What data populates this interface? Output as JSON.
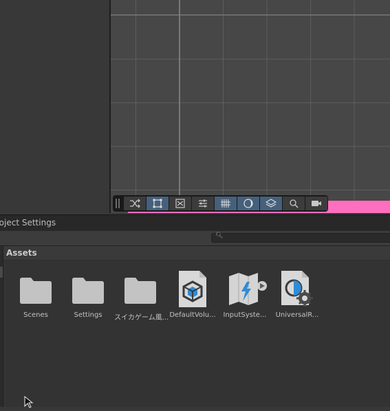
{
  "project_panel": {
    "title": "roject Settings",
    "search": {
      "icon": "search-icon",
      "placeholder": ""
    },
    "breadcrumb": "Assets"
  },
  "scene_toolbar": {
    "buttons": [
      {
        "name": "shuffle-icon",
        "active": false
      },
      {
        "name": "rect-select-icon",
        "active": true
      },
      {
        "name": "scale-tool-icon",
        "active": false
      },
      {
        "name": "sliders-icon",
        "active": false
      },
      {
        "name": "grid-hatch-icon",
        "active": true
      },
      {
        "name": "shading-mode-icon",
        "active": true
      },
      {
        "name": "layers-icon",
        "active": true
      },
      {
        "name": "magnifier-icon",
        "active": false
      },
      {
        "name": "camera-icon",
        "active": false
      }
    ]
  },
  "assets": [
    {
      "label": "Scenes",
      "icon": "folder-icon"
    },
    {
      "label": "Settings",
      "icon": "folder-icon"
    },
    {
      "label": "スイカゲーム風...",
      "icon": "folder-icon"
    },
    {
      "label": "DefaultVolu...",
      "icon": "volume-profile-icon"
    },
    {
      "label": "InputSyste...",
      "icon": "input-actions-icon"
    },
    {
      "label": "UniversalR...",
      "icon": "render-pipeline-asset-icon"
    }
  ],
  "colors": {
    "accent_pink": "#ff6fbf",
    "active_button": "#46607c",
    "scene_background": "#474747"
  }
}
